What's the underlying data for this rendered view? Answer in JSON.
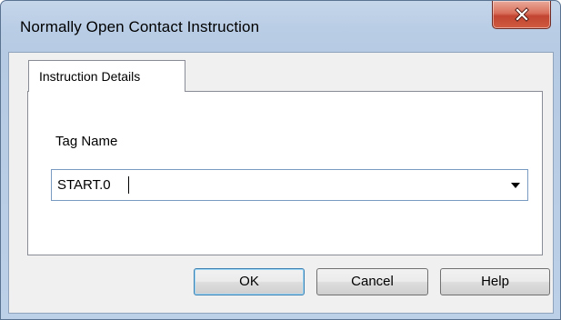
{
  "window": {
    "title": "Normally Open Contact Instruction",
    "close_icon": "close-x-icon"
  },
  "tabs": [
    {
      "label": "Instruction Details",
      "selected": true
    }
  ],
  "form": {
    "tag_name_label": "Tag Name",
    "tag_name_value": "START.0",
    "dropdown_icon": "chevron-down-icon"
  },
  "buttons": {
    "ok": "OK",
    "cancel": "Cancel",
    "help": "Help"
  }
}
